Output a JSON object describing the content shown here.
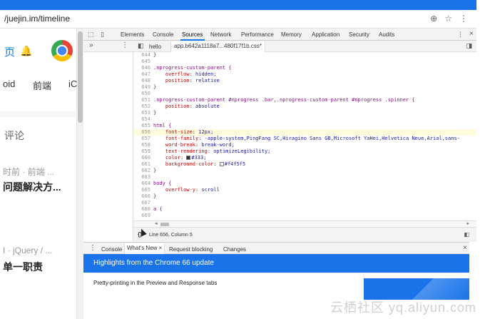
{
  "browser": {
    "url": "/juejin.im/timeline",
    "icons": [
      "zoom-icon",
      "star-icon",
      "more-icon"
    ]
  },
  "page": {
    "nav_home": "页",
    "tabs": [
      "oid",
      "前端",
      "iC"
    ],
    "comments": "评论",
    "meta1": "时前 · 前端 ...",
    "title1": "问题解决方...",
    "meta2": "I · jQuery / ...",
    "title2": "单一职责"
  },
  "devtools": {
    "tabs": [
      "Elements",
      "Console",
      "Sources",
      "Network",
      "Performance",
      "Memory",
      "Application",
      "Security",
      "Audits"
    ],
    "active_tab": "Sources",
    "file_tabs": [
      "hello",
      "app.b642a1118a7...480f17f1b.css*"
    ],
    "active_file": "app.b642a1118a7...480f17f1b.css*",
    "status": "Line 656, Column 5",
    "drawer_tabs": [
      "Console",
      "What's New",
      "Request blocking",
      "Changes"
    ],
    "active_drawer_tab": "What's New",
    "whats_new_title": "Highlights from the Chrome 66 update",
    "whats_new_line1": "Pretty-printing in the Preview and Response tabs"
  },
  "code": [
    {
      "ln": "644",
      "text": "}"
    },
    {
      "ln": "645",
      "text": ""
    },
    {
      "ln": "646",
      "text": ".nprogress-custom-parent {"
    },
    {
      "ln": "647",
      "text": "    overflow: hidden;"
    },
    {
      "ln": "648",
      "text": "    position: relative"
    },
    {
      "ln": "649",
      "text": "}"
    },
    {
      "ln": "650",
      "text": ""
    },
    {
      "ln": "651",
      "text": ".nprogress-custom-parent #nprogress .bar,.nprogress-custom-parent #nprogress .spinner {"
    },
    {
      "ln": "652",
      "text": "    position: absolute"
    },
    {
      "ln": "653",
      "text": "}"
    },
    {
      "ln": "654",
      "text": ""
    },
    {
      "ln": "655",
      "text": "html {"
    },
    {
      "ln": "656",
      "text": "    font-size: 12px;"
    },
    {
      "ln": "657",
      "text": "    font-family: -apple-system,PingFang SC,Hiragino Sans GB,Microsoft YaHei,Helvetica Neue,Arial,sans-"
    },
    {
      "ln": "658",
      "text": "    word-break: break-word;"
    },
    {
      "ln": "659",
      "text": "    text-rendering: optimizeLegibility;"
    },
    {
      "ln": "660",
      "text": "    color: #333;"
    },
    {
      "ln": "661",
      "text": "    background-color: #f4f5f5"
    },
    {
      "ln": "662",
      "text": "}"
    },
    {
      "ln": "663",
      "text": ""
    },
    {
      "ln": "664",
      "text": "body {"
    },
    {
      "ln": "665",
      "text": "    overflow-y: scroll"
    },
    {
      "ln": "666",
      "text": "}"
    },
    {
      "ln": "667",
      "text": ""
    },
    {
      "ln": "668",
      "text": "a {"
    },
    {
      "ln": "669",
      "text": ""
    }
  ],
  "highlight_line": "656",
  "colors": {
    "accent": "#1a73e8",
    "swatch_333": "#333333",
    "swatch_f4f5f5": "#f4f5f5"
  },
  "watermark": "云栖社区 yq.aliyun.com"
}
